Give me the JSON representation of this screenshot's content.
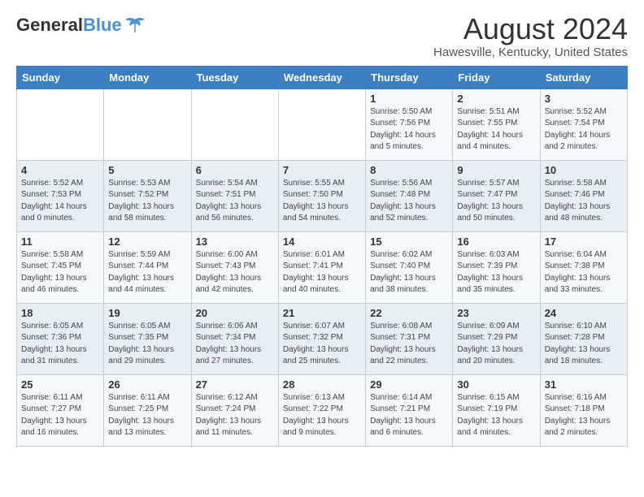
{
  "logo": {
    "general": "General",
    "blue": "Blue"
  },
  "title": "August 2024",
  "location": "Hawesville, Kentucky, United States",
  "headers": [
    "Sunday",
    "Monday",
    "Tuesday",
    "Wednesday",
    "Thursday",
    "Friday",
    "Saturday"
  ],
  "weeks": [
    [
      {
        "day": "",
        "info": ""
      },
      {
        "day": "",
        "info": ""
      },
      {
        "day": "",
        "info": ""
      },
      {
        "day": "",
        "info": ""
      },
      {
        "day": "1",
        "info": "Sunrise: 5:50 AM\nSunset: 7:56 PM\nDaylight: 14 hours\nand 5 minutes."
      },
      {
        "day": "2",
        "info": "Sunrise: 5:51 AM\nSunset: 7:55 PM\nDaylight: 14 hours\nand 4 minutes."
      },
      {
        "day": "3",
        "info": "Sunrise: 5:52 AM\nSunset: 7:54 PM\nDaylight: 14 hours\nand 2 minutes."
      }
    ],
    [
      {
        "day": "4",
        "info": "Sunrise: 5:52 AM\nSunset: 7:53 PM\nDaylight: 14 hours\nand 0 minutes."
      },
      {
        "day": "5",
        "info": "Sunrise: 5:53 AM\nSunset: 7:52 PM\nDaylight: 13 hours\nand 58 minutes."
      },
      {
        "day": "6",
        "info": "Sunrise: 5:54 AM\nSunset: 7:51 PM\nDaylight: 13 hours\nand 56 minutes."
      },
      {
        "day": "7",
        "info": "Sunrise: 5:55 AM\nSunset: 7:50 PM\nDaylight: 13 hours\nand 54 minutes."
      },
      {
        "day": "8",
        "info": "Sunrise: 5:56 AM\nSunset: 7:48 PM\nDaylight: 13 hours\nand 52 minutes."
      },
      {
        "day": "9",
        "info": "Sunrise: 5:57 AM\nSunset: 7:47 PM\nDaylight: 13 hours\nand 50 minutes."
      },
      {
        "day": "10",
        "info": "Sunrise: 5:58 AM\nSunset: 7:46 PM\nDaylight: 13 hours\nand 48 minutes."
      }
    ],
    [
      {
        "day": "11",
        "info": "Sunrise: 5:58 AM\nSunset: 7:45 PM\nDaylight: 13 hours\nand 46 minutes."
      },
      {
        "day": "12",
        "info": "Sunrise: 5:59 AM\nSunset: 7:44 PM\nDaylight: 13 hours\nand 44 minutes."
      },
      {
        "day": "13",
        "info": "Sunrise: 6:00 AM\nSunset: 7:43 PM\nDaylight: 13 hours\nand 42 minutes."
      },
      {
        "day": "14",
        "info": "Sunrise: 6:01 AM\nSunset: 7:41 PM\nDaylight: 13 hours\nand 40 minutes."
      },
      {
        "day": "15",
        "info": "Sunrise: 6:02 AM\nSunset: 7:40 PM\nDaylight: 13 hours\nand 38 minutes."
      },
      {
        "day": "16",
        "info": "Sunrise: 6:03 AM\nSunset: 7:39 PM\nDaylight: 13 hours\nand 35 minutes."
      },
      {
        "day": "17",
        "info": "Sunrise: 6:04 AM\nSunset: 7:38 PM\nDaylight: 13 hours\nand 33 minutes."
      }
    ],
    [
      {
        "day": "18",
        "info": "Sunrise: 6:05 AM\nSunset: 7:36 PM\nDaylight: 13 hours\nand 31 minutes."
      },
      {
        "day": "19",
        "info": "Sunrise: 6:05 AM\nSunset: 7:35 PM\nDaylight: 13 hours\nand 29 minutes."
      },
      {
        "day": "20",
        "info": "Sunrise: 6:06 AM\nSunset: 7:34 PM\nDaylight: 13 hours\nand 27 minutes."
      },
      {
        "day": "21",
        "info": "Sunrise: 6:07 AM\nSunset: 7:32 PM\nDaylight: 13 hours\nand 25 minutes."
      },
      {
        "day": "22",
        "info": "Sunrise: 6:08 AM\nSunset: 7:31 PM\nDaylight: 13 hours\nand 22 minutes."
      },
      {
        "day": "23",
        "info": "Sunrise: 6:09 AM\nSunset: 7:29 PM\nDaylight: 13 hours\nand 20 minutes."
      },
      {
        "day": "24",
        "info": "Sunrise: 6:10 AM\nSunset: 7:28 PM\nDaylight: 13 hours\nand 18 minutes."
      }
    ],
    [
      {
        "day": "25",
        "info": "Sunrise: 6:11 AM\nSunset: 7:27 PM\nDaylight: 13 hours\nand 16 minutes."
      },
      {
        "day": "26",
        "info": "Sunrise: 6:11 AM\nSunset: 7:25 PM\nDaylight: 13 hours\nand 13 minutes."
      },
      {
        "day": "27",
        "info": "Sunrise: 6:12 AM\nSunset: 7:24 PM\nDaylight: 13 hours\nand 11 minutes."
      },
      {
        "day": "28",
        "info": "Sunrise: 6:13 AM\nSunset: 7:22 PM\nDaylight: 13 hours\nand 9 minutes."
      },
      {
        "day": "29",
        "info": "Sunrise: 6:14 AM\nSunset: 7:21 PM\nDaylight: 13 hours\nand 6 minutes."
      },
      {
        "day": "30",
        "info": "Sunrise: 6:15 AM\nSunset: 7:19 PM\nDaylight: 13 hours\nand 4 minutes."
      },
      {
        "day": "31",
        "info": "Sunrise: 6:16 AM\nSunset: 7:18 PM\nDaylight: 13 hours\nand 2 minutes."
      }
    ]
  ]
}
